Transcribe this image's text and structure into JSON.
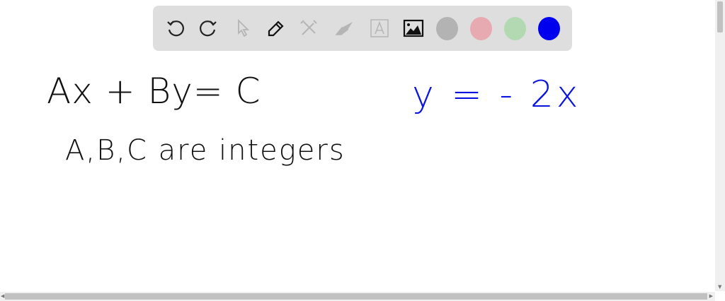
{
  "toolbar": {
    "tools": [
      "undo-icon",
      "redo-icon",
      "select-icon",
      "pen-icon",
      "tools-icon",
      "eraser-icon",
      "text-icon",
      "image-icon"
    ],
    "colors": [
      "#b3b3b3",
      "#e6aab0",
      "#b3d9b3",
      "#0000ee"
    ]
  },
  "canvas": {
    "line1": "Ax + By= C",
    "line2": "A,B,C are integers",
    "equation": "y = - 2x",
    "ink_color": "#111111",
    "equation_color": "#0a14e0"
  }
}
